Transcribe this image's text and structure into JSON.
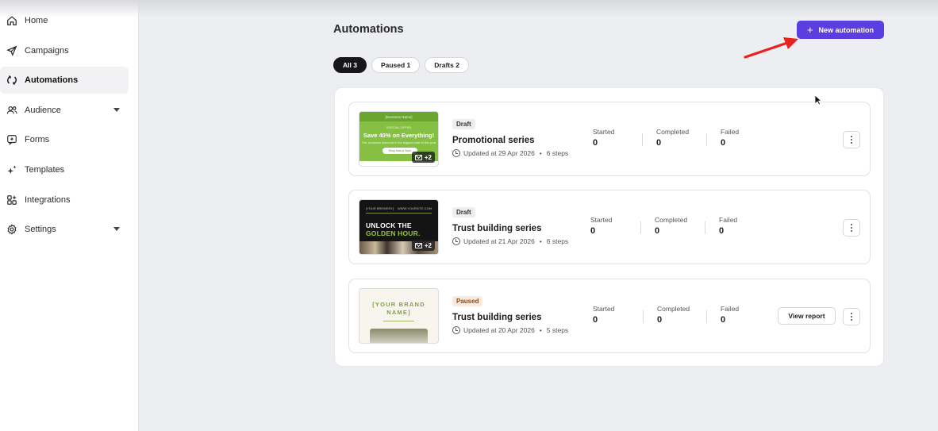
{
  "sidebar": {
    "items": [
      {
        "label": "Home",
        "icon": "home-icon"
      },
      {
        "label": "Campaigns",
        "icon": "send-icon"
      },
      {
        "label": "Automations",
        "icon": "refresh-icon",
        "active": true
      },
      {
        "label": "Audience",
        "icon": "users-icon",
        "has_caret": true
      },
      {
        "label": "Forms",
        "icon": "form-icon"
      },
      {
        "label": "Templates",
        "icon": "sparkle-icon"
      },
      {
        "label": "Integrations",
        "icon": "grid-plus-icon"
      },
      {
        "label": "Settings",
        "icon": "gear-icon",
        "has_caret": true
      }
    ]
  },
  "header": {
    "title": "Automations",
    "new_button": "New automation"
  },
  "filters": [
    {
      "label": "All 3",
      "active": true
    },
    {
      "label": "Paused 1"
    },
    {
      "label": "Drafts 2"
    }
  ],
  "stats_labels": {
    "started": "Started",
    "completed": "Completed",
    "failed": "Failed"
  },
  "automations": [
    {
      "status": "Draft",
      "title": "Promotional series",
      "updated": "Updated at 29 Apr 2026",
      "steps": "6 steps",
      "started": "0",
      "completed": "0",
      "failed": "0",
      "extra_count": "+2",
      "thumb": {
        "business": "[Business Name]",
        "special": "SPECIAL OFFER",
        "headline": "Save 40% on Everything!",
        "sub": "Our exclusive discount is the biggest sale of the year",
        "cta": "Shop Now & Save"
      }
    },
    {
      "status": "Draft",
      "title": "Trust building series",
      "updated": "Updated at 21 Apr 2026",
      "steps": "6 steps",
      "started": "0",
      "completed": "0",
      "failed": "0",
      "extra_count": "+2",
      "thumb": {
        "brand": "[YOUR BREWERY]",
        "right": "WWW.YOURSITE.COM",
        "line1": "UNLOCK THE",
        "line2": "GOLDEN HOUR."
      }
    },
    {
      "status": "Paused",
      "title": "Trust building series",
      "updated": "Updated at 20 Apr 2026",
      "steps": "5 steps",
      "started": "0",
      "completed": "0",
      "failed": "0",
      "report_button": "View report",
      "thumb": {
        "brand_line1": "[YOUR BRAND",
        "brand_line2": "NAME]"
      }
    }
  ],
  "colors": {
    "accent": "#5b3ee0",
    "annotation_arrow": "#e8211c"
  }
}
